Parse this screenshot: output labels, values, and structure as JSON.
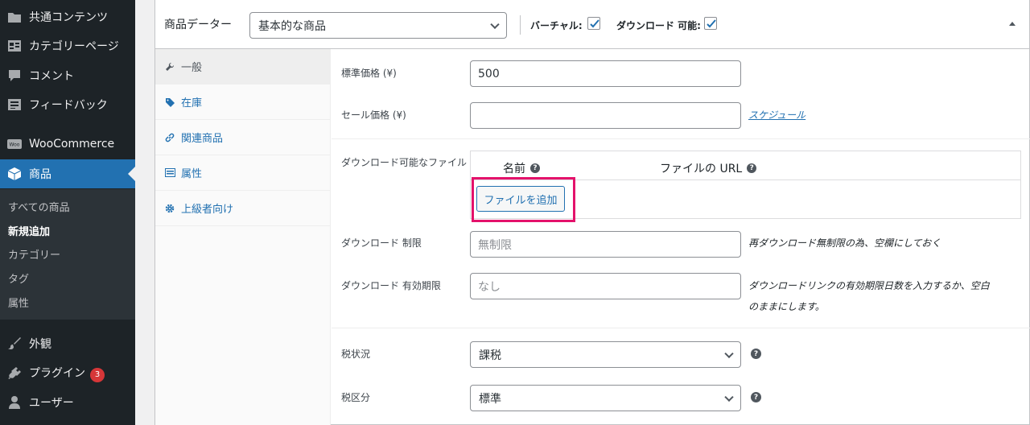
{
  "sidebar": {
    "items": [
      {
        "label": "共通コンテンツ",
        "icon": "folder-icon"
      },
      {
        "label": "カテゴリーページ",
        "icon": "layout-icon"
      },
      {
        "label": "コメント",
        "icon": "comment-icon"
      },
      {
        "label": "フィードバック",
        "icon": "feedback-icon"
      },
      {
        "label": "WooCommerce",
        "icon": "woo-icon"
      },
      {
        "label": "商品",
        "icon": "box-icon"
      },
      {
        "label": "外観",
        "icon": "brush-icon"
      },
      {
        "label": "プラグイン",
        "icon": "plugin-icon",
        "badge": "3"
      },
      {
        "label": "ユーザー",
        "icon": "user-icon"
      }
    ],
    "submenu": [
      "すべての商品",
      "新規追加",
      "カテゴリー",
      "タグ",
      "属性"
    ]
  },
  "panel": {
    "title": "商品データー",
    "product_type": "基本的な商品",
    "virtual_label": "バーチャル:",
    "downloadable_label": "ダウンロード 可能:",
    "virtual_checked": true,
    "downloadable_checked": true
  },
  "tabs": [
    {
      "label": "一般",
      "icon": "wrench-icon"
    },
    {
      "label": "在庫",
      "icon": "tag-icon"
    },
    {
      "label": "関連商品",
      "icon": "link-icon"
    },
    {
      "label": "属性",
      "icon": "list-icon"
    },
    {
      "label": "上級者向け",
      "icon": "gear-icon"
    }
  ],
  "general": {
    "regular_price_label": "標準価格 (¥)",
    "regular_price_value": "500",
    "sale_price_label": "セール価格 (¥)",
    "sale_price_value": "",
    "schedule_link": "スケジュール",
    "files_label": "ダウンロード可能なファイル",
    "files_col_name": "名前",
    "files_col_url": "ファイルの URL",
    "add_file_button": "ファイルを追加",
    "download_limit_label": "ダウンロード 制限",
    "download_limit_placeholder": "無制限",
    "download_limit_desc": "再ダウンロード無制限の為、空欄にしておく",
    "download_expiry_label": "ダウンロード 有効期限",
    "download_expiry_placeholder": "なし",
    "download_expiry_desc_1": "ダウンロードリンクの有効期限日数を入力するか、空白",
    "download_expiry_desc_2": "のままにします。",
    "tax_status_label": "税状況",
    "tax_status_value": "課税",
    "tax_class_label": "税区分",
    "tax_class_value": "標準"
  },
  "colors": {
    "admin_bg": "#1d2327",
    "accent": "#2271b1",
    "highlight": "#e4126b",
    "badge": "#d63638"
  }
}
